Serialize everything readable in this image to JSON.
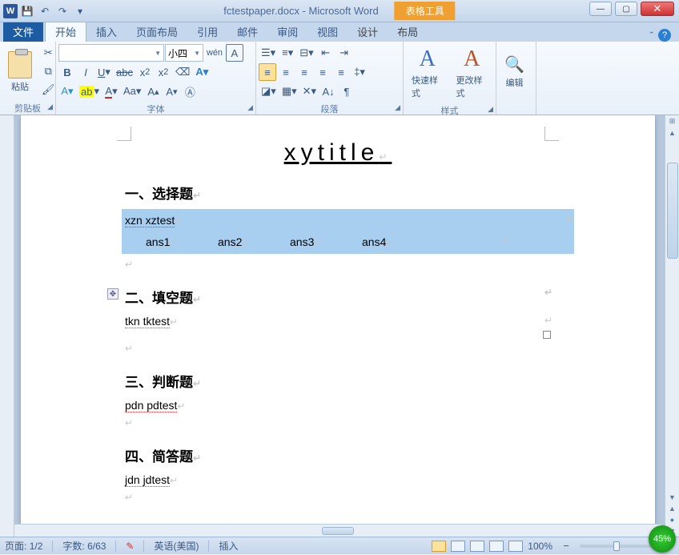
{
  "title": {
    "filename": "fctestpaper.docx",
    "app": "Microsoft Word",
    "table_tools": "表格工具"
  },
  "tabs": {
    "file": "文件",
    "home": "开始",
    "insert": "插入",
    "layout": "页面布局",
    "ref": "引用",
    "mail": "邮件",
    "review": "审阅",
    "view": "视图",
    "design": "设计",
    "tlayout": "布局"
  },
  "groups": {
    "clipboard": "剪贴板",
    "font": "字体",
    "para": "段落",
    "styles": "样式",
    "edit": "编辑",
    "paste": "粘贴",
    "quick_style": "快速样式",
    "change_style": "更改样式",
    "editing": "编辑"
  },
  "font": {
    "size": "小四"
  },
  "doc": {
    "title": "xytitle",
    "sec1": "一、选择题",
    "s1line": "xzn xztest",
    "ans": [
      "ans1",
      "ans2",
      "ans3",
      "ans4"
    ],
    "sec2": "二、填空题",
    "s2line": "tkn tktest",
    "sec3": "三、判断题",
    "s3line": "pdn pdtest",
    "sec4": "四、简答题",
    "s4line": "jdn jdtest"
  },
  "status": {
    "page_lbl": "页面:",
    "page": "1/2",
    "words_lbl": "字数:",
    "words": "6/63",
    "lang": "英语(美国)",
    "mode": "插入",
    "zoom": "100%",
    "badge": "45%"
  }
}
